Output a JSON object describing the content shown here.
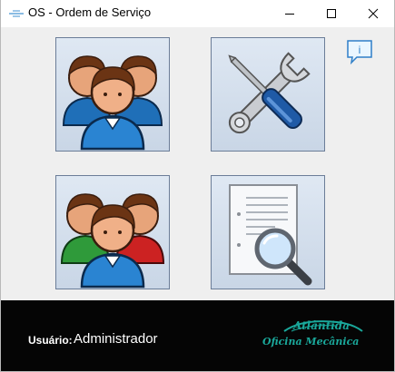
{
  "window": {
    "title": "OS - Ordem de Serviço",
    "icons": [
      "app-icon",
      "minimize-icon",
      "maximize-icon",
      "close-icon"
    ]
  },
  "tiles": [
    {
      "name": "clientes",
      "icon": "users-group-icon"
    },
    {
      "name": "servicos",
      "icon": "wrench-screwdriver-icon"
    },
    {
      "name": "usuarios",
      "icon": "users-colored-icon"
    },
    {
      "name": "relatorios",
      "icon": "document-search-icon"
    }
  ],
  "info_button": {
    "label": "i",
    "icon": "info-speech-icon"
  },
  "footer": {
    "user_label": "Usuário:",
    "user_value": "Administrador"
  },
  "brand": {
    "line1": "Atlântida",
    "line2": "Oficina Mecânica",
    "color": "#1aa89b"
  },
  "colors": {
    "footer_bg": "#050505",
    "content_bg": "#efefef"
  }
}
